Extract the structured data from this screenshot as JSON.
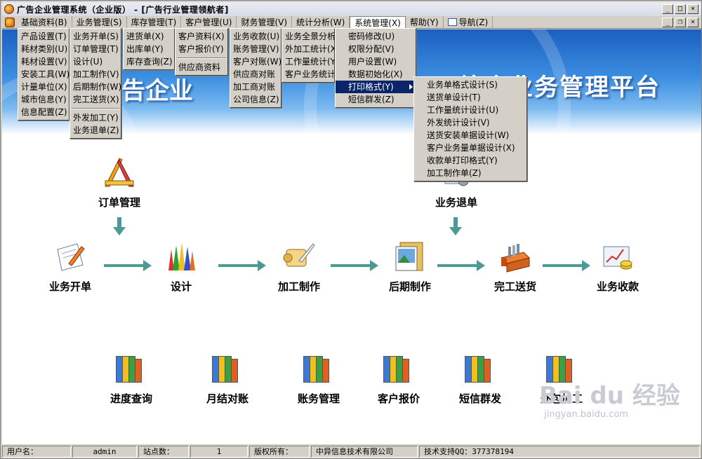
{
  "window": {
    "title": "广告企业管理系统（企业版） - [广告行业管理领航者]"
  },
  "menubar": {
    "items": [
      {
        "label": "基础资料(B)"
      },
      {
        "label": "业务管理(S)"
      },
      {
        "label": "库存管理(T)"
      },
      {
        "label": "客户管理(U)"
      },
      {
        "label": "财务管理(V)"
      },
      {
        "label": "统计分析(W)"
      },
      {
        "label": "系统管理(X)"
      },
      {
        "label": "帮助(Y)"
      },
      {
        "label": "导航(Z)"
      }
    ]
  },
  "menus": {
    "jichu": [
      "产品设置(T)",
      "耗材类别(U)",
      "耗材设置(V)",
      "安装工具(W)",
      "计量单位(X)",
      "城市信息(Y)",
      "信息配置(Z)"
    ],
    "yewu": [
      "业务开单(S)",
      "订单管理(T)",
      "设计(U)",
      "加工制作(V)",
      "后期制作(W)",
      "完工送货(X)",
      "外发加工(Y)",
      "业务退单(Z)"
    ],
    "kucun": [
      "进货单(X)",
      "出库单(Y)",
      "库存查询(Z)"
    ],
    "kehu": [
      "客户资料(X)",
      "客户报价(Y)",
      "供应商资料"
    ],
    "caiwu": [
      "业务收款(U)",
      "账务管理(V)",
      "客户对账(W)",
      "供应商对账",
      "加工商对账",
      "公司信息(Z)"
    ],
    "tongji": [
      "业务全景分析",
      "外加工统计(X)",
      "工作量统计(Y)",
      "客户业务统计"
    ],
    "xitong": [
      "密码修改(U)",
      "权限分配(V)",
      "用户设置(W)",
      "数据初始化(X)",
      "打印格式(Y)",
      "短信群发(Z)"
    ],
    "dayin": [
      "业务单格式设计(S)",
      "送货单设计(T)",
      "工作量统计设计(U)",
      "外发统计设计(V)",
      "送货安装单据设计(W)",
      "客户业务量单据设计(X)",
      "收款单打印格式(Y)",
      "加工制作单(Z)"
    ]
  },
  "banner": {
    "title": "综合业务管理平台",
    "left_fragment": "告企业"
  },
  "flow": {
    "top_left": "订单管理",
    "top_right": "业务退单",
    "steps": [
      "业务开单",
      "设计",
      "加工制作",
      "后期制作",
      "完工送货",
      "业务收款"
    ]
  },
  "shortcuts": [
    "进度查询",
    "月结对账",
    "账务管理",
    "客户报价",
    "短信群发",
    "外包加工"
  ],
  "watermark": {
    "main": "Bai du 经验",
    "sub": "jingyan.baidu.com"
  },
  "statusbar": {
    "user_label": "用户名：",
    "user_value": "admin",
    "site_label": "站点数：",
    "site_value": "1",
    "copyright_label": "版权所有：",
    "copyright_value": "中异信息技术有限公司",
    "support": "技术支持QQ：377378194"
  },
  "colors": {
    "menu_highlight": "#0a246a",
    "flow_arrow": "#4a9a95",
    "banner": "#2a7ad6"
  }
}
